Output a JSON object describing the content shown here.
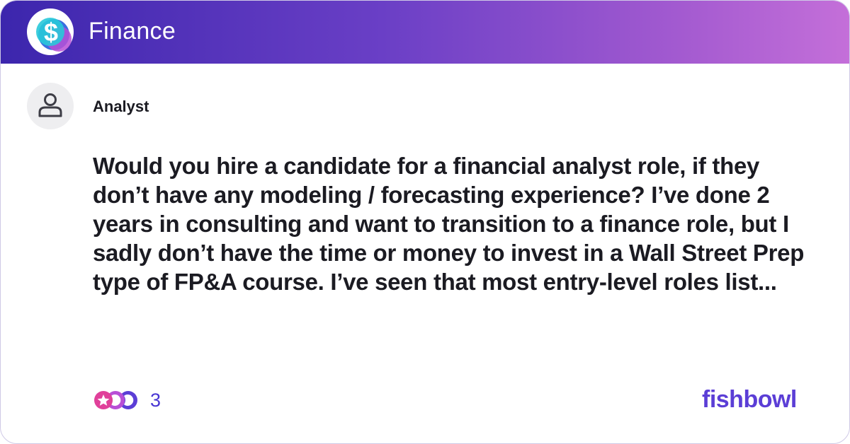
{
  "header": {
    "title": "Finance",
    "logo_icon": "dollar-sign-icon",
    "gradient": [
      "#3c26ad",
      "#c46fd9"
    ]
  },
  "post": {
    "author": "Analyst",
    "avatar_icon": "user-icon",
    "text": "Would you hire a candidate for a financial analyst role, if they don’t have any modeling / forecasting experience? I’ve done 2 years in consulting and want to transition to a finance role, but I sadly don’t have the time or money to invest in a Wall Street Prep type of FP&A course. I’ve seen that most entry-level roles list..."
  },
  "footer": {
    "reactions_icon": "reactions-icon",
    "reaction_count": "3",
    "brand": "fishbowl",
    "accent": "#5b3ed6"
  }
}
